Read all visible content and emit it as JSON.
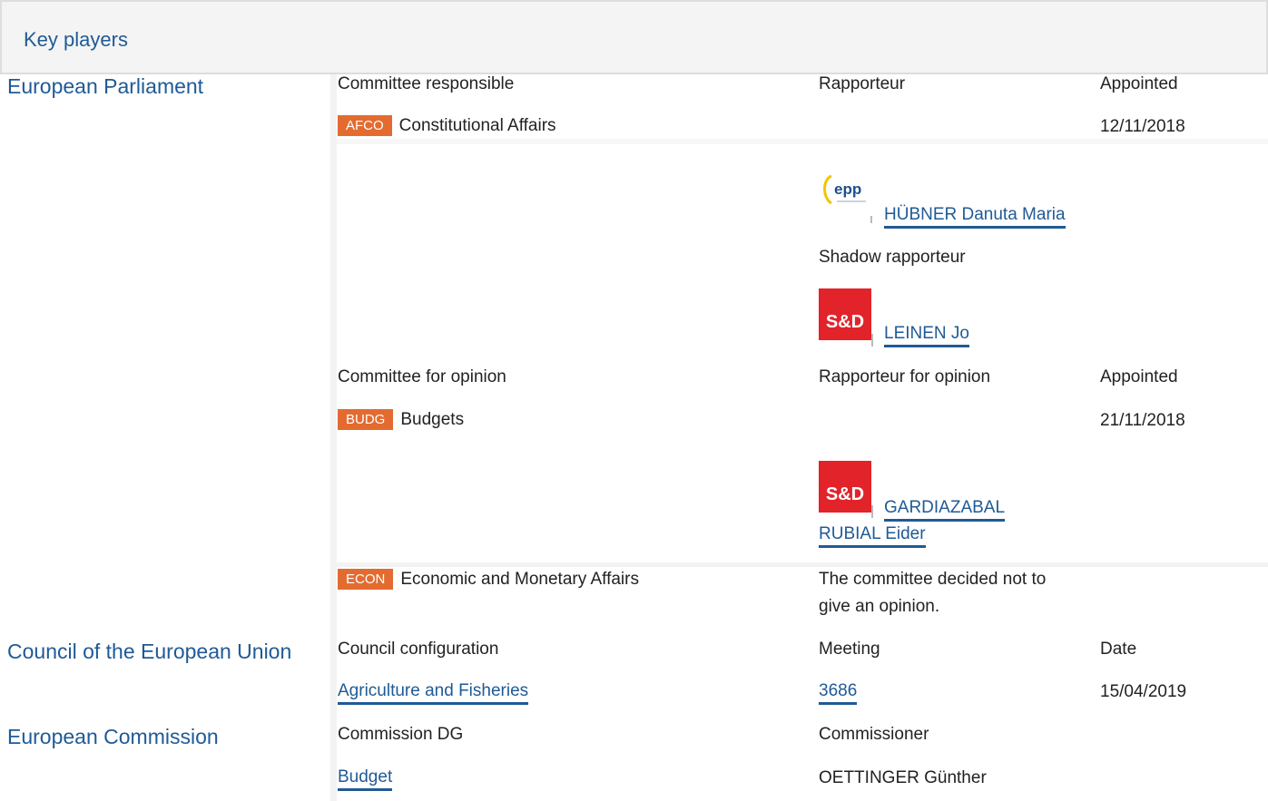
{
  "section_title": "Key players",
  "institutions": {
    "parliament": "European Parliament",
    "council": "Council of the European Union",
    "commission": "European Commission"
  },
  "parliament": {
    "col_committee_responsible": "Committee responsible",
    "col_rapporteur": "Rapporteur",
    "col_appointed": "Appointed",
    "afco": {
      "badge": "AFCO",
      "name": "Constitutional Affairs",
      "appointed": "12/11/2018"
    },
    "rapporteur_name": "HÜBNER Danuta Maria",
    "shadow_label": "Shadow rapporteur",
    "shadow_name": "LEINEN Jo",
    "col_committee_opinion": "Committee for opinion",
    "col_rapporteur_opinion": "Rapporteur for opinion",
    "col_appointed2": "Appointed",
    "budg": {
      "badge": "BUDG",
      "name": "Budgets",
      "appointed": "21/11/2018"
    },
    "opinion_rapporteur_line1": "GARDIAZABAL",
    "opinion_rapporteur_line2": "RUBIAL Eider",
    "econ": {
      "badge": "ECON",
      "name": "Economic and Monetary Affairs"
    },
    "econ_note_line1": "The committee decided not to",
    "econ_note_line2": "give an opinion."
  },
  "logos": {
    "epp_text": "epp",
    "sd_text": "S&D"
  },
  "council": {
    "col_configuration": "Council configuration",
    "col_meeting": "Meeting",
    "col_date": "Date",
    "configuration": "Agriculture and Fisheries",
    "meeting": "3686",
    "date": "15/04/2019"
  },
  "commission": {
    "col_dg": "Commission DG",
    "col_commissioner": "Commissioner",
    "dg": "Budget",
    "commissioner": "OETTINGER Günther"
  },
  "colors": {
    "link": "#1f5a96",
    "badge": "#e36b30",
    "sd_red": "#e2242a"
  }
}
